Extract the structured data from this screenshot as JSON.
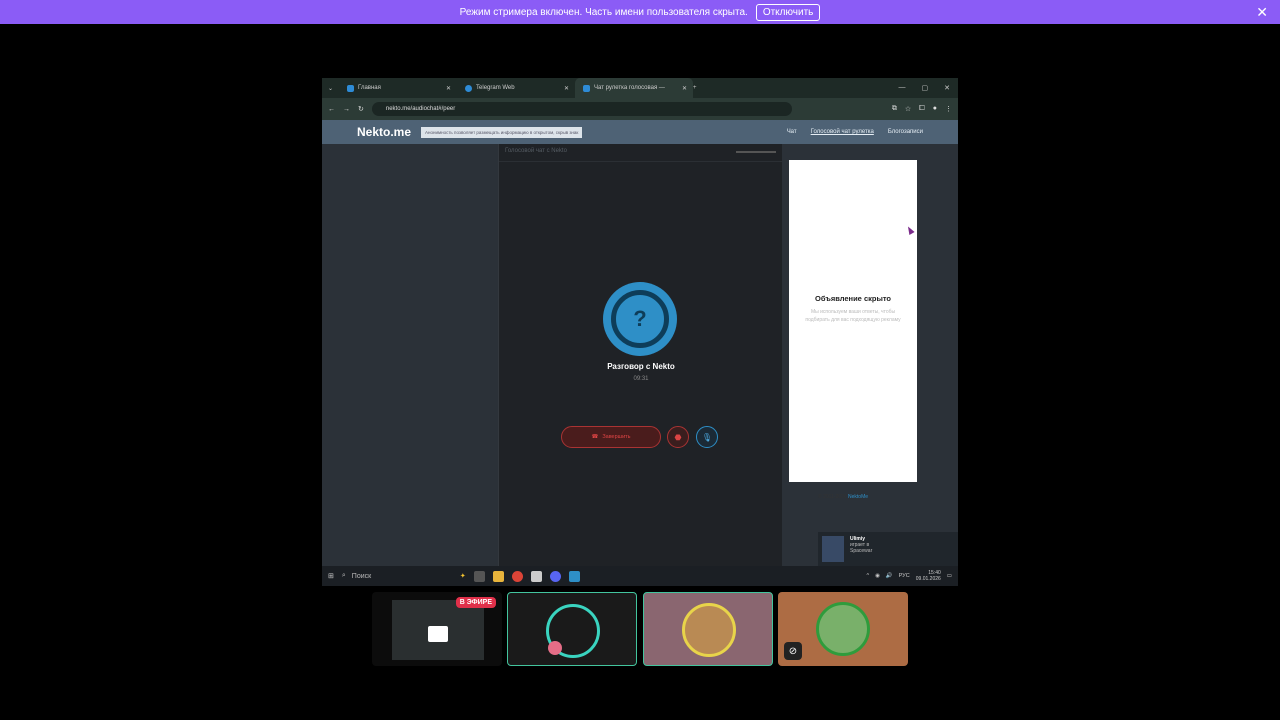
{
  "banner": {
    "text": "Режим стримера включен. Часть имени пользователя скрыта.",
    "button": "Отключить"
  },
  "browser": {
    "tabs": [
      {
        "label": "Главная"
      },
      {
        "label": "Telegram Web"
      },
      {
        "label": "Чат рулетка голосовая — "
      }
    ],
    "url": "nekto.me/audiochat#/peer"
  },
  "site": {
    "logo": "Nekto.me",
    "notice": "Анонимность позволяет размещать информацию в открытом, скрыв знак",
    "nav": [
      "Чат",
      "Голосовой чат рулетка",
      "Блогозаписи"
    ]
  },
  "chat": {
    "title": "Голосовой чат с Nekto",
    "avatar_glyph": "?",
    "conversation": "Разговор с Nekto",
    "timer": "09:31",
    "end_button": "Завершить"
  },
  "ad": {
    "title": "Объявление скрыто",
    "text": "Мы используем ваши ответы, чтобы подбирать для вас подходящую рекламу"
  },
  "footer": {
    "copyright": "© 2011-2026",
    "link": "NektoMe"
  },
  "toast": {
    "name": "Ulimiy",
    "status": "играет в",
    "game": "Spacewar"
  },
  "taskbar": {
    "search": "Поиск",
    "lang": "РУС",
    "time": "15:40",
    "date": "09.01.2026"
  },
  "participants": {
    "live_badge": "В ЭФИРЕ"
  },
  "colors": {
    "banner": "#8b5cf6",
    "accent": "#2e8fc7",
    "speaking": "#43c59e",
    "danger": "#d44444"
  }
}
